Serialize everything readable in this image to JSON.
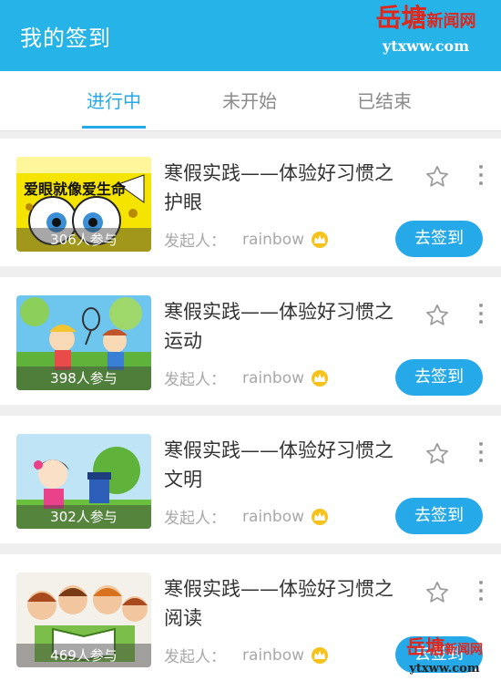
{
  "header": {
    "title": "我的签到",
    "background": "#26b3e8"
  },
  "watermark": {
    "brand_big": "岳塘",
    "brand_small": "新闻网",
    "url": "ytxww.com"
  },
  "tabs": [
    {
      "label": "进行中",
      "active": true
    },
    {
      "label": "未开始",
      "active": false
    },
    {
      "label": "已结束",
      "active": false
    }
  ],
  "accent_color": "#26a9e8",
  "activities": [
    {
      "title": "寒假实践——体验好习惯之护眼",
      "participants": "306人参与",
      "initiator_label": "发起人：",
      "initiator_name": "rainbow",
      "action_label": "去签到",
      "thumbnail": "eye-care-cartoon",
      "thumb_caption": "爱眼就像爱生命"
    },
    {
      "title": "寒假实践——体验好习惯之运动",
      "participants": "398人参与",
      "initiator_label": "发起人：",
      "initiator_name": "rainbow",
      "action_label": "去签到",
      "thumbnail": "tennis-kids-cartoon"
    },
    {
      "title": "寒假实践——体验好习惯之文明",
      "participants": "302人参与",
      "initiator_label": "发起人：",
      "initiator_name": "rainbow",
      "action_label": "去签到",
      "thumbnail": "mailbox-girl-cartoon"
    },
    {
      "title": "寒假实践——体验好习惯之阅读",
      "participants": "469人参与",
      "initiator_label": "发起人：",
      "initiator_name": "rainbow",
      "action_label": "去签到",
      "thumbnail": "reading-kids-cartoon"
    }
  ]
}
